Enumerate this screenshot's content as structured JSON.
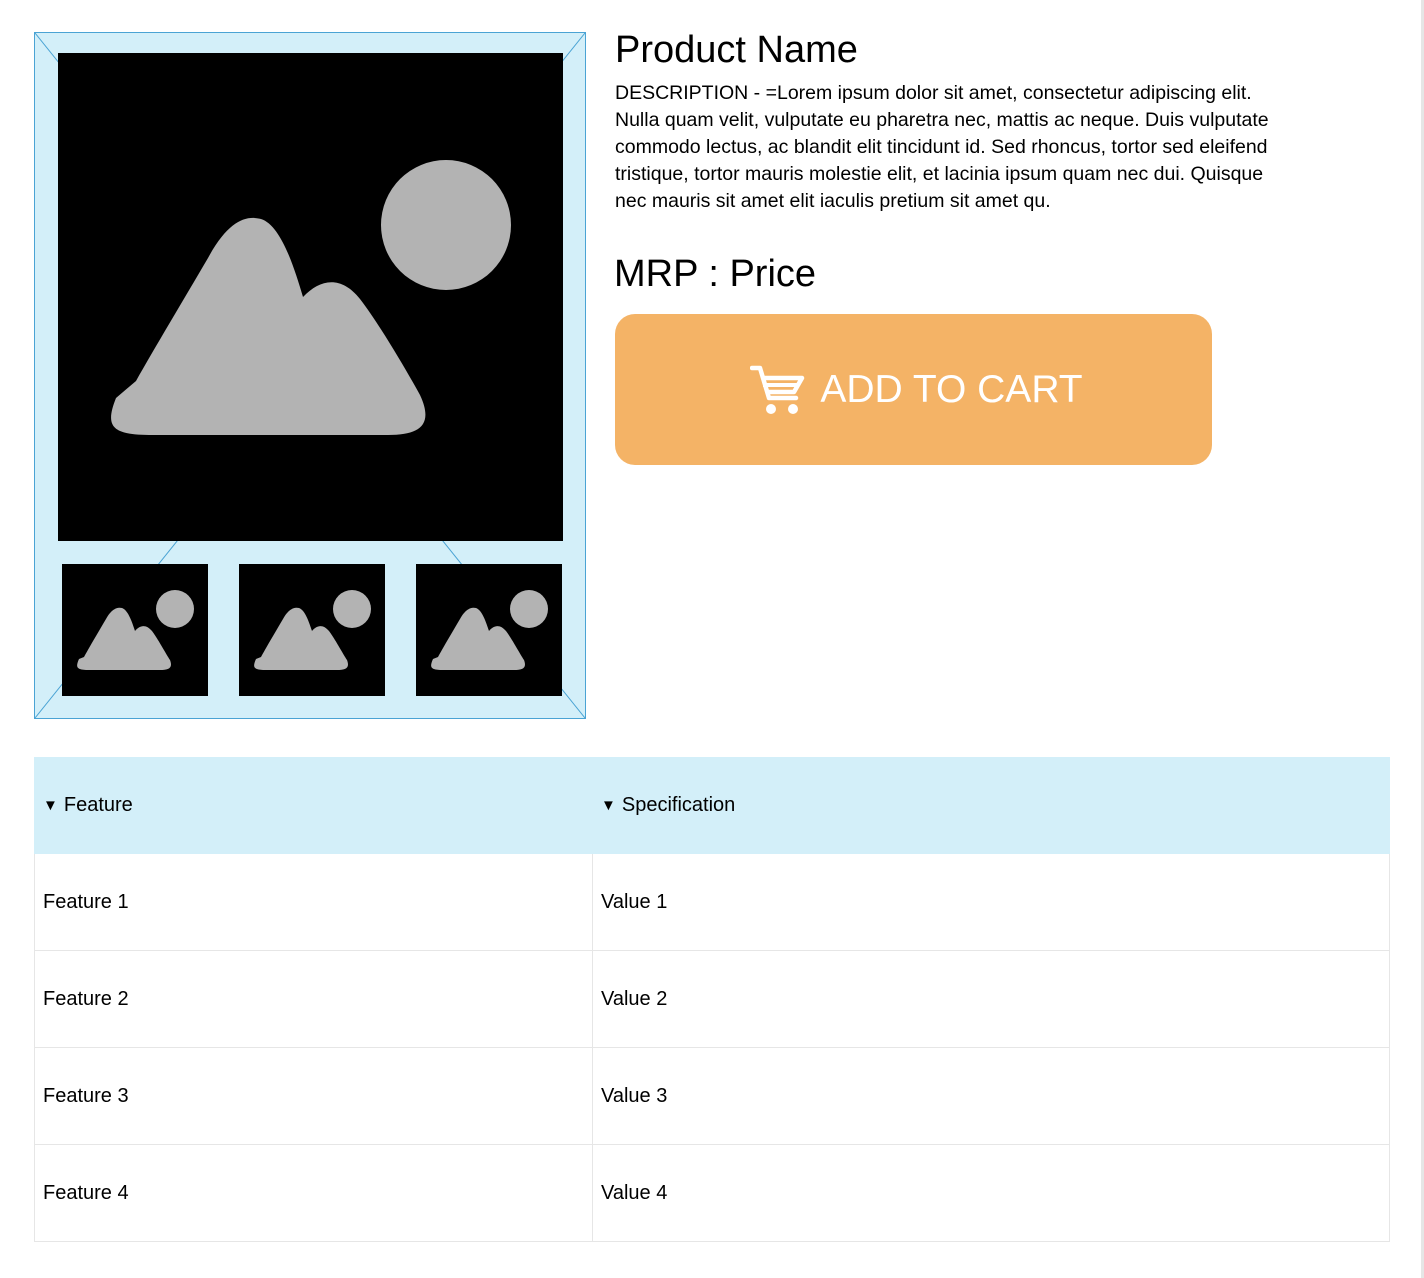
{
  "gallery": {
    "main_image": {
      "icon": "image-placeholder-icon",
      "alt": "Main product image"
    },
    "thumbnails": [
      {
        "icon": "image-placeholder-icon"
      },
      {
        "icon": "image-placeholder-icon"
      },
      {
        "icon": "image-placeholder-icon"
      }
    ]
  },
  "product": {
    "name": "Product Name",
    "description": "DESCRIPTION - =Lorem ipsum dolor sit amet, consectetur adipiscing elit. Nulla quam velit, vulputate eu pharetra nec, mattis ac neque. Duis vulputate commodo lectus, ac blandit elit tincidunt id. Sed rhoncus, tortor sed eleifend tristique, tortor mauris molestie elit, et lacinia ipsum quam nec dui. Quisque nec mauris sit amet elit iaculis pretium sit amet qu.",
    "price_label": "MRP",
    "price_separator": " : ",
    "price_value": "Price"
  },
  "cart_button": {
    "label": "ADD TO CART",
    "icon": "shopping-cart-icon",
    "color": "#f4b366",
    "text_color": "#ffffff"
  },
  "table": {
    "headers": [
      {
        "label": "Feature",
        "icon": "sort-down-icon"
      },
      {
        "label": "Specification",
        "icon": "sort-down-icon"
      }
    ],
    "rows": [
      {
        "feature": "Feature 1",
        "value": "Value 1"
      },
      {
        "feature": "Feature 2",
        "value": "Value 2"
      },
      {
        "feature": "Feature 3",
        "value": "Value 3"
      },
      {
        "feature": "Feature 4",
        "value": "Value 4"
      }
    ],
    "header_bg": "#d3eff9"
  },
  "colors": {
    "gallery_bg": "#d3eff9",
    "gallery_border": "#4aa3d4",
    "placeholder_fill": "#b3b3b3",
    "image_bg": "#000000"
  }
}
